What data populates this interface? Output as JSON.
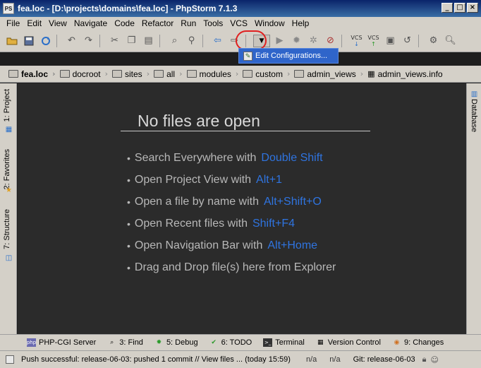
{
  "window": {
    "title": "fea.loc - [D:\\projects\\domains\\fea.loc] - PhpStorm 7.1.3",
    "app_icon_text": "PS",
    "minimize": "_",
    "maximize": "□",
    "close": "×"
  },
  "menubar": {
    "items": [
      "File",
      "Edit",
      "View",
      "Navigate",
      "Code",
      "Refactor",
      "Run",
      "Tools",
      "VCS",
      "Window",
      "Help"
    ]
  },
  "toolbar": {
    "icons": [
      "open-folder-icon",
      "save-all-icon",
      "sync-icon",
      "undo-icon",
      "redo-icon",
      "cut-icon",
      "copy-icon",
      "paste-icon",
      "find-icon",
      "replace-icon",
      "back-icon",
      "forward-icon",
      "run-config-dropdown",
      "run-icon",
      "debug-icon",
      "coverage-icon",
      "stop-icon",
      "vcs-update-icon",
      "vcs-commit-icon",
      "vcs-history-icon",
      "vcs-revert-icon",
      "settings-icon",
      "search-everywhere-icon"
    ],
    "vcs_label": "VCS",
    "run_dropdown_glyph": "▼"
  },
  "popup": {
    "label": "Edit Configurations..."
  },
  "navbar": {
    "crumbs": [
      "fea.loc",
      "docroot",
      "sites",
      "all",
      "modules",
      "custom",
      "admin_views",
      "admin_views.info"
    ]
  },
  "left_tool_tabs": {
    "project": "1: Project",
    "favorites": "2: Favorites",
    "structure": "7: Structure"
  },
  "right_tool_tabs": {
    "database": "Database"
  },
  "editor": {
    "empty_title": "No files are open",
    "tips": [
      {
        "text": "Search Everywhere with",
        "key": "Double Shift"
      },
      {
        "text": "Open Project View with",
        "key": "Alt+1"
      },
      {
        "text": "Open a file by name with",
        "key": "Alt+Shift+O"
      },
      {
        "text": "Open Recent files with",
        "key": "Shift+F4"
      },
      {
        "text": "Open Navigation Bar with",
        "key": "Alt+Home"
      },
      {
        "text": "Drag and Drop file(s) here from Explorer",
        "key": ""
      }
    ],
    "bullet": "•"
  },
  "tool_windows": {
    "php_cgi": "PHP-CGI Server",
    "find": "3: Find",
    "debug": "5: Debug",
    "todo": "6: TODO",
    "terminal": "Terminal",
    "version_control": "Version Control",
    "changes": "9: Changes"
  },
  "status": {
    "message": "Push successful: release-06-03: pushed 1 commit // View files ... (today 15:59)",
    "na1": "n/a",
    "na2": "n/a",
    "git": "Git: release-06-03"
  },
  "colors": {
    "editor_bg": "#2b2b2b",
    "shortcut_blue": "#2f74e0",
    "tip_text": "#b8b8b8",
    "highlight_red": "#e02020"
  }
}
